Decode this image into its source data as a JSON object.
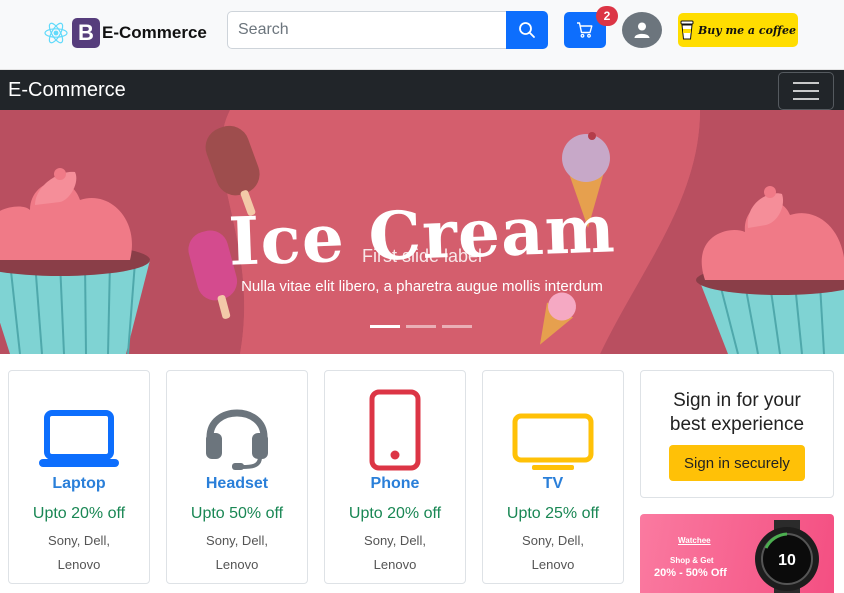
{
  "header": {
    "brand": "E-Commerce",
    "logo_letter": "B",
    "search_placeholder": "Search",
    "cart_count": "2",
    "coffee_label": "Buy me a coffee"
  },
  "navbar": {
    "brand": "E-Commerce"
  },
  "carousel": {
    "banner_title": "Ice Cream",
    "slide_label": "First slide label",
    "slide_text": "Nulla vitae elit libero, a pharetra augue mollis interdum",
    "indicators": 3,
    "active_index": 0
  },
  "products": [
    {
      "name": "Laptop",
      "offer": "Upto 20% off",
      "brands_line1": "Sony, Dell,",
      "brands_line2": "Lenovo",
      "icon": "laptop-icon",
      "color": "#0d6efd"
    },
    {
      "name": "Headset",
      "offer": "Upto 50% off",
      "brands_line1": "Sony, Dell,",
      "brands_line2": "Lenovo",
      "icon": "headset-icon",
      "color": "#6c757d"
    },
    {
      "name": "Phone",
      "offer": "Upto 20% off",
      "brands_line1": "Sony, Dell,",
      "brands_line2": "Lenovo",
      "icon": "phone-icon",
      "color": "#dc3545"
    },
    {
      "name": "TV",
      "offer": "Upto 25% off",
      "brands_line1": "Sony, Dell,",
      "brands_line2": "Lenovo",
      "icon": "tv-icon",
      "color": "#ffc107"
    }
  ],
  "signin": {
    "title_line1": "Sign in for your",
    "title_line2": "best experience",
    "button": "Sign in securely"
  },
  "promo": {
    "brand": "Watchee",
    "subtitle": "Shop & Get",
    "discount": "20% - 50% Off"
  },
  "colors": {
    "primary": "#0d6efd",
    "navbar": "#212529",
    "banner": "#cf5f70",
    "success": "#198754",
    "warning": "#ffc107"
  }
}
